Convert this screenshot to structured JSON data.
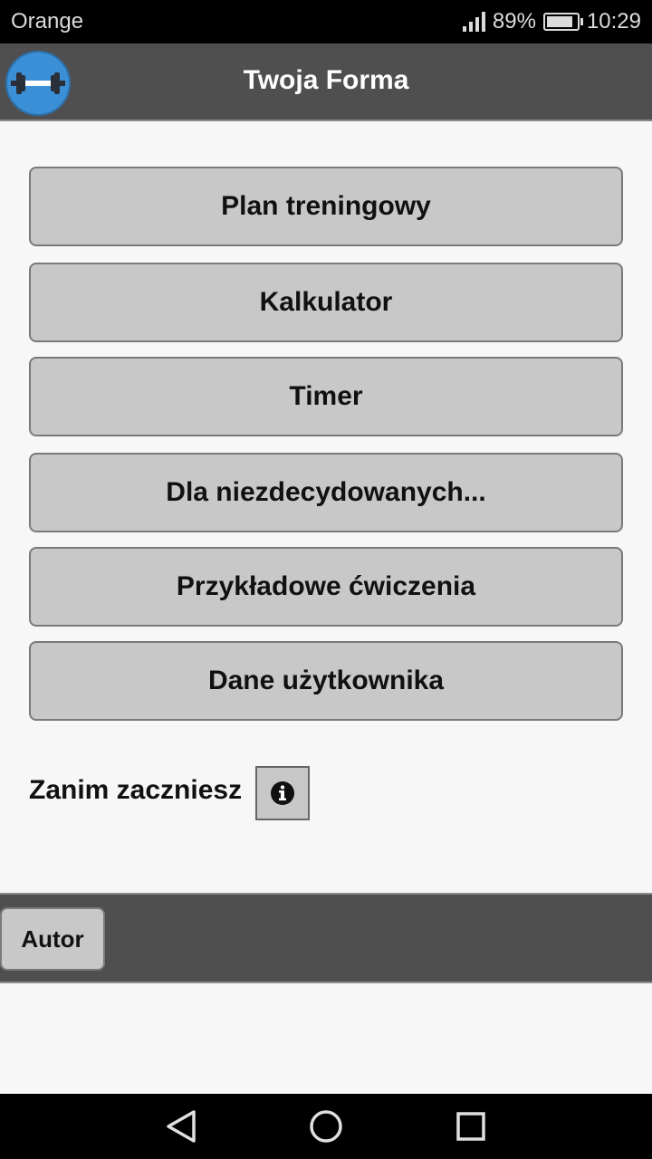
{
  "status_bar": {
    "carrier": "Orange",
    "battery_percent_text": "89%",
    "battery_level": 0.89,
    "time": "10:29",
    "signal_icon": "signal-icon",
    "battery_icon": "battery-icon"
  },
  "app_bar": {
    "title": "Twoja Forma",
    "logo_icon": "dumbbell-icon"
  },
  "menu": {
    "items": [
      {
        "label": "Plan treningowy"
      },
      {
        "label": "Kalkulator"
      },
      {
        "label": "Timer"
      },
      {
        "label": "Dla niezdecydowanych..."
      },
      {
        "label": "Przykładowe ćwiczenia"
      },
      {
        "label": "Dane użytkownika"
      }
    ]
  },
  "before_start": {
    "label": "Zanim zaczniesz",
    "info_icon": "info-icon"
  },
  "footer": {
    "author_label": "Autor"
  },
  "nav_bar": {
    "back_icon": "back-triangle-icon",
    "home_icon": "home-circle-icon",
    "recents_icon": "recents-square-icon"
  },
  "colors": {
    "app_bar": "#4f4f4f",
    "button_bg": "#c8c8c8",
    "logo_blue": "#3a8fd6",
    "background": "#f7f7f7"
  }
}
